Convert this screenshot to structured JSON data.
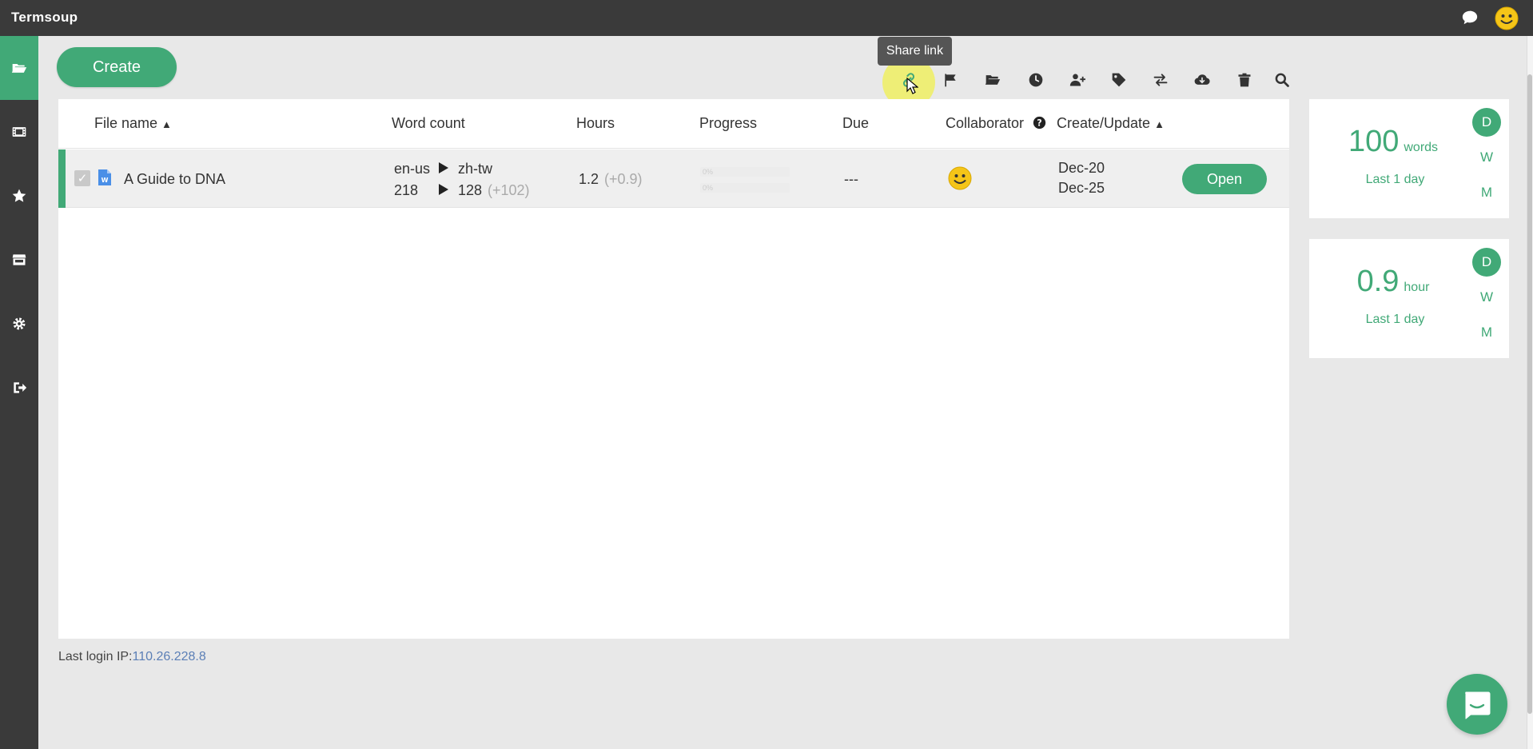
{
  "app": {
    "title": "Termsoup"
  },
  "toolbar": {
    "create_label": "Create",
    "tooltip": "Share link",
    "icons": [
      "share-link",
      "flag",
      "folder-open",
      "clock",
      "user-plus",
      "tag",
      "exchange",
      "cloud-download",
      "trash",
      "search"
    ]
  },
  "table": {
    "columns": {
      "file_name": "File name",
      "word_count": "Word count",
      "hours": "Hours",
      "progress": "Progress",
      "due": "Due",
      "collaborator": "Collaborator",
      "create_update": "Create/Update"
    },
    "rows": [
      {
        "file_name": "A Guide to DNA",
        "source_lang": "en-us",
        "target_lang": "zh-tw",
        "source_count": "218",
        "target_count": "128",
        "count_delta": "(+102)",
        "hours": "1.2",
        "hours_delta": "(+0.9)",
        "progress_top": 0.0,
        "progress_bottom": 0.0,
        "progress_top_label": "0%",
        "progress_bottom_label": "0%",
        "due": "---",
        "created": "Dec-20",
        "updated": "Dec-25",
        "open_label": "Open"
      }
    ]
  },
  "footer": {
    "last_login_label": "Last login IP:",
    "last_login_ip": "110.26.228.8"
  },
  "stats": [
    {
      "value": "100",
      "unit": "words",
      "period": "Last 1 day",
      "options": [
        "D",
        "W",
        "M"
      ],
      "selected": "D"
    },
    {
      "value": "0.9",
      "unit": "hour",
      "period": "Last 1 day",
      "options": [
        "D",
        "W",
        "M"
      ],
      "selected": "D"
    }
  ],
  "colors": {
    "accent": "#41a977",
    "topbar": "#3a3a3a",
    "background": "#e8e8e8",
    "link": "#5b7fb6"
  }
}
